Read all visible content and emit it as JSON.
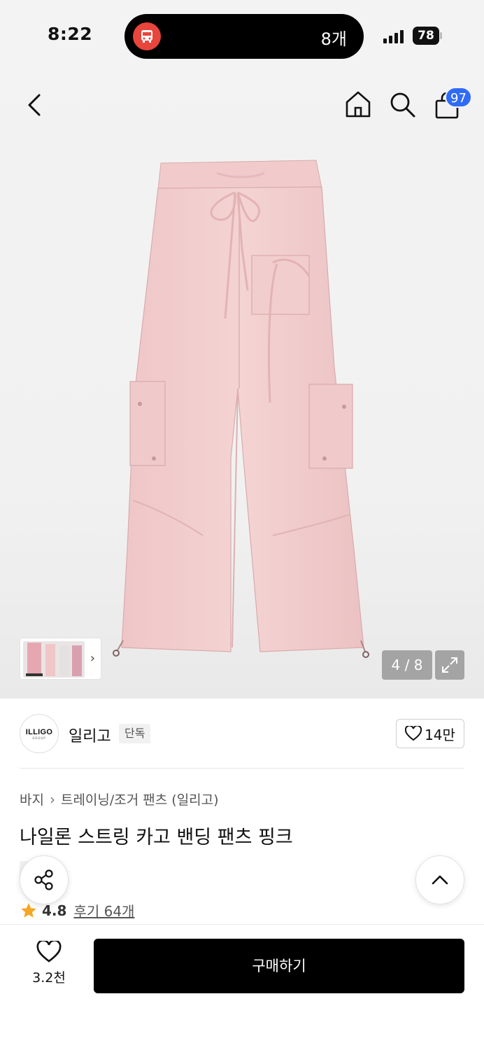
{
  "status_bar": {
    "time": "8:22",
    "island_count": "8개",
    "battery": "78"
  },
  "nav": {
    "cart_badge": "97"
  },
  "gallery": {
    "pager": "4 / 8",
    "product_color": "#f2cfd0"
  },
  "brand": {
    "logo_text": "ILLIGO",
    "logo_sub": "GROUP",
    "name": "일리고",
    "tag": "단독",
    "likes": "14만"
  },
  "product": {
    "breadcrumb": [
      "바지",
      "트레이닝/조거 팬츠 (일리고)"
    ],
    "title": "나일론 스트링 카고 밴딩 팬츠 핑크",
    "exclusive_tag": "단독",
    "rating": "4.8",
    "reviews": "후기 64개"
  },
  "bottom_bar": {
    "wish_count": "3.2천",
    "buy_label": "구매하기"
  },
  "colors": {
    "accent_badge": "#2f6bf6",
    "star": "#f5a623",
    "buy_button": "#000000"
  }
}
